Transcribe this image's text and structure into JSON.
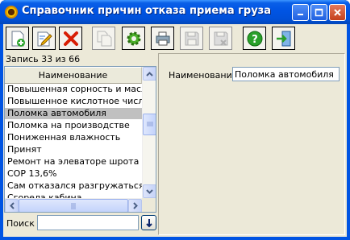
{
  "window": {
    "title": "Справочник причин отказа приема груза",
    "icons": [
      "app-sunflower-icon",
      "minimize-icon",
      "maximize-icon",
      "close-icon"
    ]
  },
  "toolbar": {
    "buttons": [
      {
        "name": "add-record",
        "icon": "add-document-icon",
        "enabled": true
      },
      {
        "name": "edit-record",
        "icon": "edit-pencil-icon",
        "enabled": true
      },
      {
        "name": "delete-record",
        "icon": "red-x-icon",
        "enabled": true
      },
      {
        "name": "copy-record",
        "icon": "copy-icon",
        "enabled": false
      },
      {
        "name": "settings",
        "icon": "gear-icon",
        "enabled": true
      },
      {
        "name": "print",
        "icon": "printer-icon",
        "enabled": true
      },
      {
        "name": "save",
        "icon": "floppy-disk-icon",
        "enabled": false
      },
      {
        "name": "save-all",
        "icon": "floppy-disk-multi-icon",
        "enabled": false
      },
      {
        "name": "help",
        "icon": "help-question-icon",
        "enabled": true
      },
      {
        "name": "exit",
        "icon": "exit-door-icon",
        "enabled": true
      }
    ]
  },
  "list": {
    "record_status": "Запись 33 из 66",
    "column_header": "Наименование",
    "selected_index": 2,
    "rows": [
      "Повышенная сорность и масличн",
      "Повышенное кислотное число",
      "Поломка автомобиля",
      "Поломка на производстве",
      "Пониженная влажность",
      "Принят",
      "Ремонт на элеваторе шрота",
      "СОР 13,6%",
      "Сам отказался разгружаться.",
      "Сгорела кабина"
    ]
  },
  "search": {
    "label": "Поиск",
    "value": "",
    "placeholder": ""
  },
  "detail": {
    "field_label": "Наименование",
    "field_value": "Поломка автомобиля"
  },
  "colors": {
    "titlebar": "#0054e3",
    "face": "#ece9d8",
    "selection": "#c0c0c0"
  }
}
